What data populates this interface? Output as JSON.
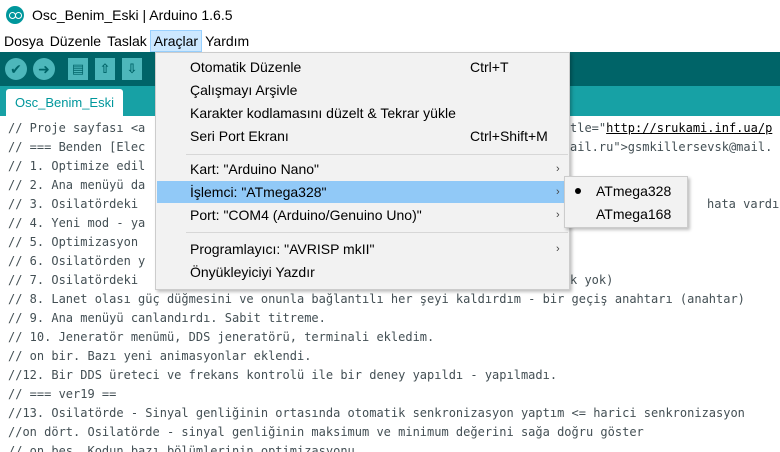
{
  "window": {
    "title": "Osc_Benim_Eski | Arduino 1.6.5"
  },
  "menubar": {
    "items": [
      "Dosya",
      "Düzenle",
      "Taslak",
      "Araçlar",
      "Yardım"
    ],
    "active": "Araçlar"
  },
  "toolbar": {
    "icons": [
      "verify-icon",
      "upload-icon",
      "new-icon",
      "open-icon",
      "save-icon"
    ],
    "verify_glyph": "✔",
    "upload_glyph": "➜",
    "new_glyph": "▤",
    "open_glyph": "⇧",
    "save_glyph": "⇩"
  },
  "tabs": {
    "active_label": "Osc_Benim_Eski"
  },
  "tools_menu": {
    "items": [
      {
        "label": "Otomatik Düzenle",
        "shortcut": "Ctrl+T"
      },
      {
        "label": "Çalışmayı Arşivle",
        "shortcut": ""
      },
      {
        "label": "Karakter kodlamasını düzelt & Tekrar yükle",
        "shortcut": ""
      },
      {
        "label": "Seri Port Ekranı",
        "shortcut": "Ctrl+Shift+M"
      },
      {
        "label": "Kart: \"Arduino Nano\"",
        "submenu": true
      },
      {
        "label": "İşlemci: \"ATmega328\"",
        "submenu": true,
        "highlighted": true
      },
      {
        "label": "Port: \"COM4 (Arduino/Genuino Uno)\"",
        "submenu": true
      },
      {
        "label": "Programlayıcı: \"AVRISP mkII\"",
        "submenu": true
      },
      {
        "label": "Önyükleyiciyi Yazdır",
        "shortcut": ""
      }
    ],
    "arrow_glyph": "›"
  },
  "processor_submenu": {
    "items": [
      {
        "label": "ATmega328",
        "selected": true
      },
      {
        "label": "ATmega168",
        "selected": false
      }
    ]
  },
  "editor": {
    "lines": [
      "// Proje sayfası <a",
      "// === Benden [Elec",
      "// 1. Optimize edil",
      "// 2. Ana menüyü da",
      "// 3. Osilatördeki",
      "// 4. Yeni mod - ya",
      "// 5. Optimizasyon",
      "// 6. Osilatörden y",
      "// 7. Osilatördeki",
      "// 8. Lanet olası güç düğmesini ve onunla bağlantılı her şeyi kaldırdım - bir geçiş anahtarı (anahtar)",
      "// 9. Ana menüyü canlandırdı. Sabit titreme.",
      "// 10. Jeneratör menümü, DDS jeneratörü, terminali ekledim.",
      "// on bir. Bazı yeni animasyonlar eklendi.",
      "//12. Bir DDS üreteci ve frekans kontrolü ile bir deney yapıldı - yapılmadı.",
      "// === ver19 ==",
      "//13. Osilatörde - Sinyal genliğinin ortasında otomatik senkronizasyon yaptım <= harici senkronizasyon",
      "//on dört. Osilatörde - sinyal genliğinin maksimum ve minimum değerini sağa doğru göster",
      "// on beş. Kodun bazı bölümlerinin optimizasyonu"
    ],
    "line1_right_pre": "tle=\"",
    "line1_right_link": "http://srukami.inf.ua/p",
    "line2_right_pre": "ail.ru\">gsmkillersevsk@mail.",
    "line5_right": "hata vardı)",
    "line9_right": "k yok)"
  },
  "colors": {
    "toolbar_bg": "#006468",
    "tabstrip_bg": "#17a1a5",
    "accent": "#00979c",
    "menu_highlight": "#91c9f7"
  }
}
